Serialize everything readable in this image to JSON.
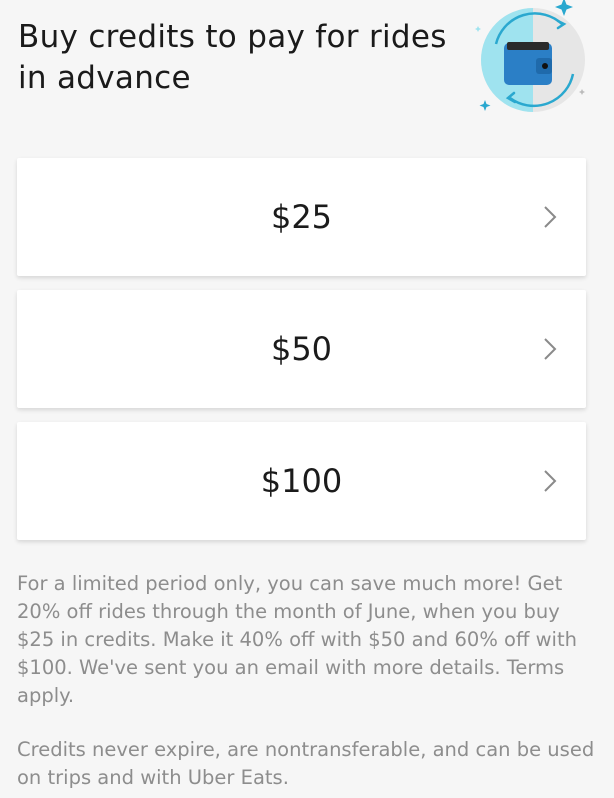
{
  "header": {
    "title": "Buy credits to pay for rides in advance",
    "illustration_icon": "wallet-refresh-icon"
  },
  "options": [
    {
      "amount": "$25",
      "icon": "chevron-right-icon"
    },
    {
      "amount": "$50",
      "icon": "chevron-right-icon"
    },
    {
      "amount": "$100",
      "icon": "chevron-right-icon"
    }
  ],
  "promo_text": "For a limited period only, you can save much more! Get 20% off rides through the month of June, when you buy $25 in credits. Make it 40% off with $50 and 60% off with $100. We've sent you an email with more details. Terms apply.",
  "credits_note": "Credits never expire, are nontransferable, and can be used on trips and with Uber Eats.",
  "colors": {
    "background": "#f6f6f6",
    "card": "#ffffff",
    "secondary_text": "#8d8d8d",
    "accent_cyan": "#2db5d4",
    "wallet_blue": "#2a82c7"
  }
}
